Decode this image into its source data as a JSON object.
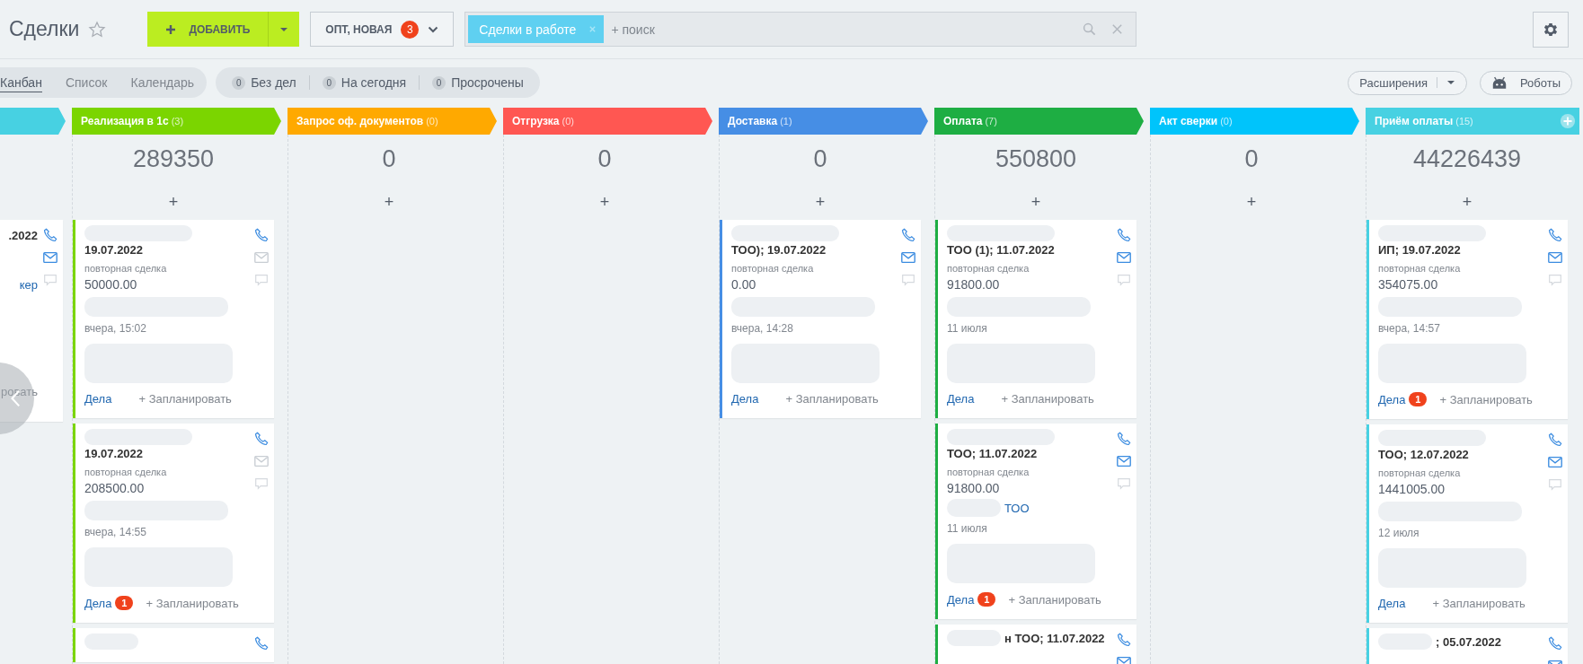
{
  "header": {
    "title": "Сделки",
    "add_button": "ДОБАВИТЬ",
    "filter_preset": {
      "label": "ОПТ, НОВАЯ",
      "badge": "3"
    },
    "search": {
      "tags": [
        "Сделки в работе"
      ],
      "placeholder": "+ поиск"
    }
  },
  "views": [
    {
      "label": "Канбан",
      "selected": true
    },
    {
      "label": "Список",
      "selected": false
    },
    {
      "label": "Календарь",
      "selected": false
    }
  ],
  "counters": [
    {
      "count": "0",
      "label": "Без дел"
    },
    {
      "count": "0",
      "label": "На сегодня"
    },
    {
      "count": "0",
      "label": "Просрочены"
    }
  ],
  "toolbar": {
    "extensions": "Расширения",
    "robots": "Роботы"
  },
  "columns": [
    {
      "color": "#47d1e2",
      "cards": [
        {
          "kind": "partial",
          "title": ".2022",
          "contact": "кер",
          "plan": "ровать",
          "email": true
        }
      ]
    },
    {
      "title": "Реализация в 1с",
      "count": "(3)",
      "color": "#7bd500",
      "total": "289350",
      "add": "+",
      "cards": [
        {
          "kind": "full",
          "title": "19.07.2022",
          "note": "повторная сделка",
          "amount": "50000.00",
          "date": "вчера, 15:02",
          "tasks": "Дела",
          "plan": "+ Запланировать",
          "email": false
        },
        {
          "kind": "full",
          "title": "19.07.2022",
          "note": "повторная сделка",
          "amount": "208500.00",
          "date": "вчера, 14:55",
          "tasks": "Дела",
          "badge": "1",
          "plan": "+ Запланировать",
          "email": false
        },
        {
          "kind": "full"
        }
      ]
    },
    {
      "title": "Запрос оф. документов",
      "count": "(0)",
      "color": "#ffa900",
      "total": "0",
      "add": "+"
    },
    {
      "title": "Отгрузка",
      "count": "(0)",
      "color": "#ff5752",
      "total": "0",
      "add": "+"
    },
    {
      "title": "Доставка",
      "count": "(1)",
      "color": "#468ee5",
      "total": "0",
      "add": "+",
      "cards": [
        {
          "kind": "full",
          "title": "ТОО); 19.07.2022",
          "note": "повторная сделка",
          "amount": "0.00",
          "date": "вчера, 14:28",
          "tasks": "Дела",
          "plan": "+ Запланировать",
          "email": true
        }
      ]
    },
    {
      "title": "Оплата",
      "count": "(7)",
      "color": "#1eae43",
      "total": "550800",
      "add": "+",
      "cards": [
        {
          "kind": "full",
          "title": "ТОО (1); 11.07.2022",
          "note": "повторная сделка",
          "amount": "91800.00",
          "date": "11 июля",
          "tasks": "Дела",
          "plan": "+ Запланировать",
          "email": true
        },
        {
          "kind": "full",
          "title": "ТОО; 11.07.2022",
          "note": "повторная сделка",
          "amount": "91800.00",
          "contact": "ТОО",
          "date": "11 июля",
          "tasks": "Дела",
          "badge": "1",
          "plan": "+ Запланировать",
          "email": true
        },
        {
          "kind": "full",
          "title": "н ТОО; 11.07.2022",
          "email": true
        }
      ]
    },
    {
      "title": "Акт сверки",
      "count": "(0)",
      "color": "#00c4fb",
      "total": "0",
      "add": "+"
    },
    {
      "title": "Приём оплаты",
      "count": "(15)",
      "color": "#47d1e2",
      "total": "44226439",
      "add": "+",
      "cards": [
        {
          "kind": "full",
          "title": "ИП; 19.07.2022",
          "note": "повторная сделка",
          "amount": "354075.00",
          "date": "вчера, 14:57",
          "tasks": "Дела",
          "badge": "1",
          "plan": "+ Запланировать",
          "email": true
        },
        {
          "kind": "full",
          "title": "ТОО; 12.07.2022",
          "note": "повторная сделка",
          "amount": "1441005.00",
          "date": "12 июля",
          "tasks": "Дела",
          "plan": "+ Запланировать",
          "email": true
        },
        {
          "kind": "full",
          "title": "; 05.07.2022",
          "email": true
        }
      ]
    }
  ]
}
